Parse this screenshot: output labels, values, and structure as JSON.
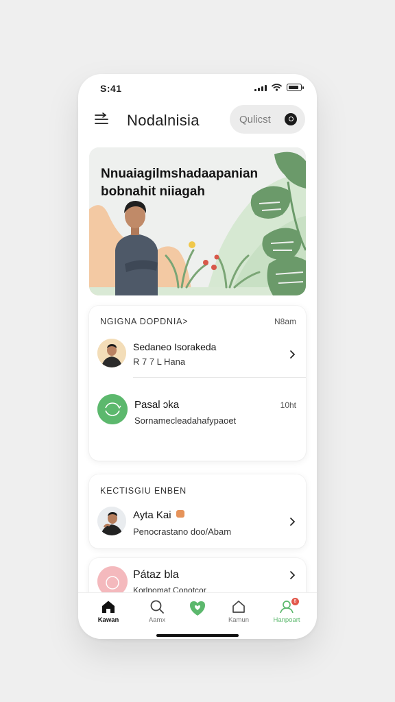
{
  "status_bar": {
    "time": "S:41"
  },
  "header": {
    "title": "Nodalnisia",
    "search_placeholder": "Qulicst"
  },
  "hero": {
    "title": "Nnuaiagilmshadaapanian bobnahit niiagah"
  },
  "section1": {
    "label": "NGIGNA DOPDNIA>",
    "meta": "N8am",
    "items": [
      {
        "title": "Sedaneo Isorakeda",
        "subtitle": "R 7 7  L Hana"
      },
      {
        "title": "Pasal ɔka",
        "subtitle": "Sornamecleadahafypaoet",
        "meta": "10ht"
      }
    ]
  },
  "section2": {
    "label": "KECTISGIU ENBEN",
    "items": [
      {
        "title": "Ayta Kai",
        "subtitle": "Penocrastano doo/Abam"
      },
      {
        "title": "Pátaz bla",
        "subtitle": "Korlnomat Conotcor"
      }
    ]
  },
  "tabs": [
    {
      "label": "Kawan",
      "icon": "home-icon"
    },
    {
      "label": "Aamx",
      "icon": "search-icon"
    },
    {
      "label": "",
      "icon": "heart-shield-icon"
    },
    {
      "label": "Kamun",
      "icon": "home-outline-icon"
    },
    {
      "label": "Hanpoart",
      "icon": "profile-icon",
      "badge": "8"
    }
  ],
  "colors": {
    "accent_green": "#5cb86d",
    "hero_background": "#eef0ee",
    "peach": "#f3c9a3",
    "leaf": "#6b9a6a",
    "pink_avatar": "#f4b9bd",
    "badge_red": "#e2584b"
  }
}
